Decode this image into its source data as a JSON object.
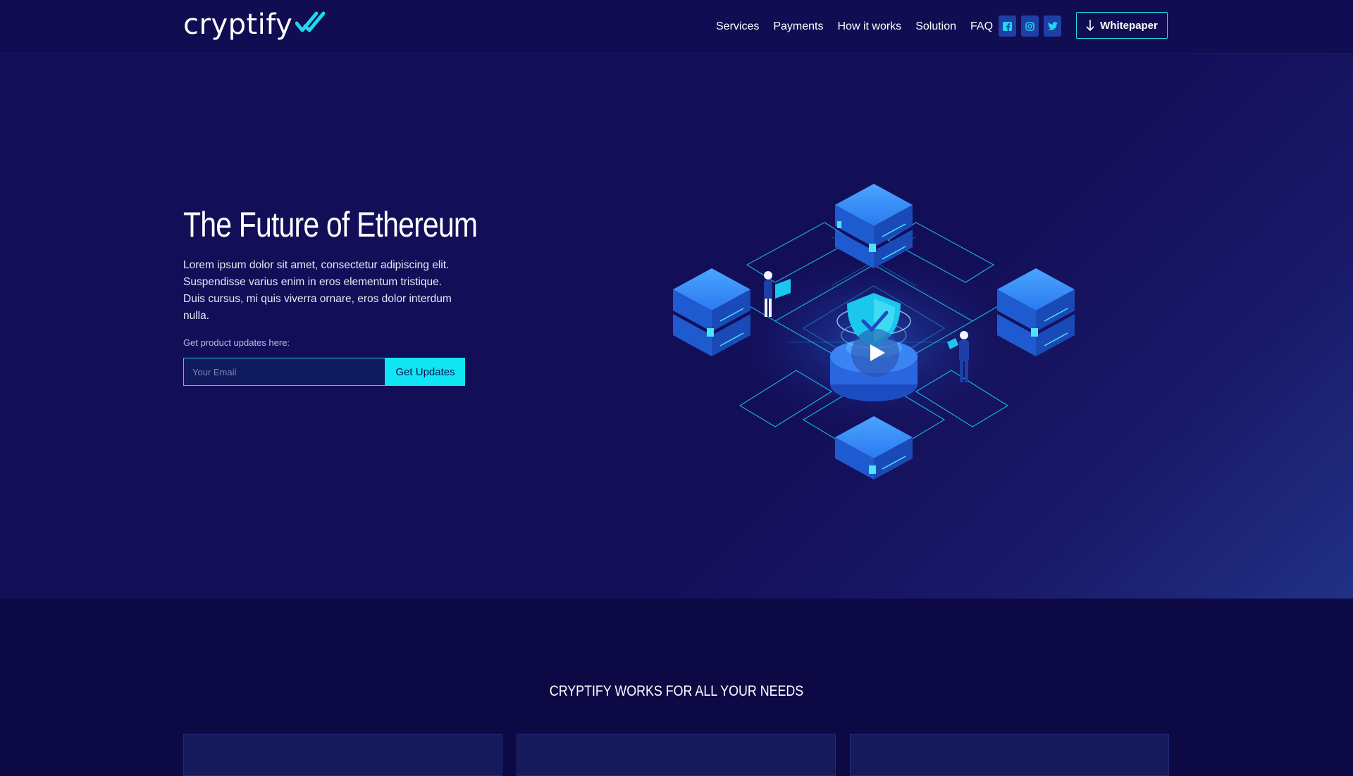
{
  "header": {
    "logo_text": "cryptify",
    "nav": [
      "Services",
      "Payments",
      "How it works",
      "Solution",
      "FAQ"
    ],
    "social_icons": [
      "facebook-icon",
      "instagram-icon",
      "twitter-icon"
    ],
    "whitepaper_label": "Whitepaper"
  },
  "hero": {
    "title": "The Future of Ethereum",
    "description": "Lorem ipsum dolor sit amet, consectetur adipiscing elit. Suspendisse varius enim in eros elementum tristique. Duis cursus, mi quis viverra ornare, eros dolor interdum nulla.",
    "updates_label": "Get product updates here:",
    "email_placeholder": "Your Email",
    "button_label": "Get Updates"
  },
  "section": {
    "title": "CRYPTIFY WORKS FOR ALL YOUR NEEDS"
  },
  "colors": {
    "background": "#130e58",
    "accent": "#10e6f4",
    "server_blue": "#1f6fe0"
  }
}
